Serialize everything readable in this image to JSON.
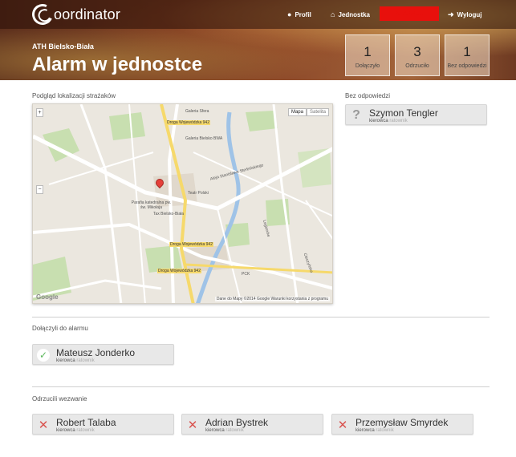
{
  "app": {
    "logo_text": "oordinator"
  },
  "nav": {
    "profile": "Profil",
    "unit": "Jednostka",
    "alarm": "ALARMUJ",
    "logout": "Wyloguj"
  },
  "header": {
    "unit_name": "ATH Bielsko-Biała",
    "title": "Alarm w jednostce"
  },
  "stats": [
    {
      "value": "1",
      "label": "Dołączyło"
    },
    {
      "value": "3",
      "label": "Odrzuciło"
    },
    {
      "value": "1",
      "label": "Bez odpowiedzi"
    }
  ],
  "map": {
    "label": "Podgląd lokalizacji strażaków",
    "type_map": "Mapa",
    "type_satellite": "Satelita",
    "zoom_in": "+",
    "zoom_out": "−",
    "footer": "Dane do Mapy ©2014 Google   Warunki korzystania z programu",
    "google": "Google",
    "streets": {
      "s1": "Galeria Sfera",
      "s2": "Galeria Bielsko BWA",
      "s3": "Teatr Polski",
      "s4": "Parafia katedralna pw. św. Mikołaja",
      "s5": "Tax Bielsko-Biała",
      "s6": "Aleja Stanisława Sterbińskiego",
      "s7": "Droga Wojewódzka 942",
      "s8": "PCK",
      "s9": "Legionów",
      "s10": "Cieszyńska"
    }
  },
  "no_response": {
    "label": "Bez odpowiedzi",
    "people": [
      {
        "name": "Szymon Tengler",
        "role": "kierowca",
        "tag": "ratownik"
      }
    ]
  },
  "joined": {
    "label": "Dołączyli do alarmu",
    "people": [
      {
        "name": "Mateusz Jonderko",
        "role": "kierowca",
        "tag": "ratownik"
      }
    ]
  },
  "declined": {
    "label": "Odrzucili wezwanie",
    "people": [
      {
        "name": "Robert Talaba",
        "role": "kierowca",
        "tag": "ratownik"
      },
      {
        "name": "Adrian Bystrek",
        "role": "kierowca",
        "tag": "ratownik"
      },
      {
        "name": "Przemysław Smyrdek",
        "role": "kierowca",
        "tag": "ratownik"
      }
    ]
  }
}
